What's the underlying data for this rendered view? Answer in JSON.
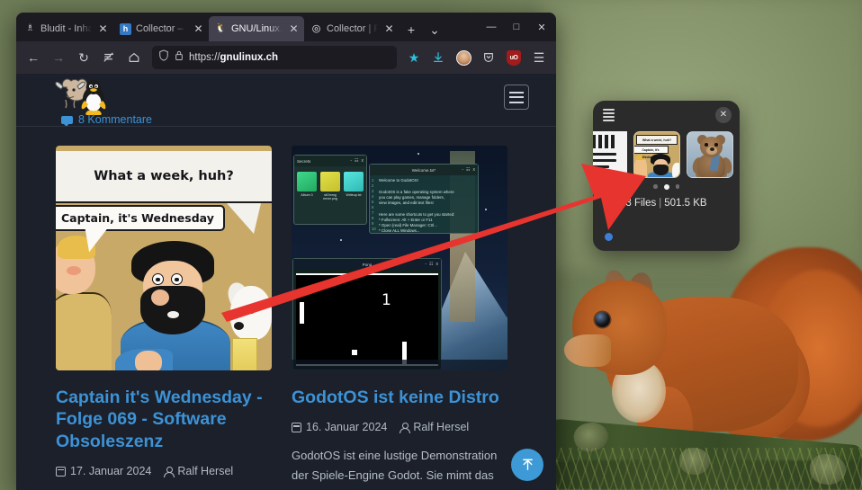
{
  "browser": {
    "tabs": [
      {
        "title": "Bludit - Inha",
        "favicon": "bludit-icon",
        "active": false
      },
      {
        "title": "Collector – N",
        "favicon": "h-icon",
        "active": false
      },
      {
        "title": "GNU/Linux.c",
        "favicon": "gnulinux-icon",
        "active": true
      },
      {
        "title": "Collector | F",
        "favicon": "collector-icon",
        "active": false
      }
    ],
    "new_tab_label": "+",
    "tab_list_label": "⌄",
    "window_controls": {
      "minimize": "—",
      "maximize": "□",
      "close": "✕"
    },
    "nav": {
      "back": "←",
      "forward": "→",
      "reload": "↻",
      "reader": "reader-mode",
      "home": "⌂"
    },
    "urlbar": {
      "shield_icon": "shield-icon",
      "lock_icon": "lock-icon",
      "protocol": "https://",
      "domain": "gnulinux.ch",
      "bookmark_icon": "star-filled-icon",
      "bookmark_color": "#2ac3de"
    },
    "toolbar_right": {
      "downloads": "↓",
      "account": "account-avatar",
      "pocket": "pocket-icon",
      "ublock": "uO",
      "ublock_color": "#a31c1c",
      "appmenu": "☰"
    }
  },
  "site": {
    "logo": "gnu-tux-logo",
    "menu_button": "hamburger-menu",
    "comments_link": "8 Kommentare",
    "articles": [
      {
        "title": "Captain it's Wednesday - Folge 069 - Software Obsoleszenz",
        "date": "17. Januar 2024",
        "author": "Ralf Hersel",
        "thumb": "tintin-comic",
        "comic_bubble_top": "What a week, huh?",
        "comic_bubble_bottom": "Captain, it's Wednesday",
        "excerpt": ""
      },
      {
        "title": "GodotOS ist keine Distro",
        "date": "16. Januar 2024",
        "author": "Ralf Hersel",
        "thumb": "godotos-screenshot",
        "excerpt": "GodotOS ist eine lustige Demonstration der Spiele-Engine Godot. Sie mimt das"
      }
    ],
    "godot_window_titles": {
      "folder": "Secrets",
      "text": "Welcome.txt*",
      "game": "Pong"
    },
    "godot_files": [
      "Album 3",
      "stOmmg never.png",
      "Writeup.txt"
    ],
    "godot_text_lines": [
      "Welcome to GodotOS!",
      "",
      "GodotOS is a fake operating system where",
      "you can play games, manage folders,",
      "view images, and edit text files!",
      "",
      "Here are some shortcuts to get you started:",
      "  * Fullscreen: Alt + Enter or F11",
      "  * Open (real) File Manager: Ctrl...",
      "  * Close ALL Windows..."
    ],
    "godot_line_numbers": [
      "1",
      "2",
      "3",
      "4",
      "5",
      "6",
      "7",
      "8",
      "9",
      "10"
    ],
    "pong_score": "1",
    "scroll_top_button": "↑"
  },
  "collector": {
    "menu_icon": "hamburger-menu-icon",
    "close_icon": "✕",
    "thumbnails": [
      {
        "name": "document-thumbnail",
        "kind": "document"
      },
      {
        "name": "comic-thumbnail",
        "kind": "image",
        "caption_top": "What a week, huh?",
        "caption_bottom": "Captain, it's Wednesday"
      },
      {
        "name": "teddy-bear-thumbnail",
        "kind": "image"
      }
    ],
    "pager": {
      "count": 3,
      "active_index": 1
    },
    "file_count": "3 Files",
    "separator": "|",
    "total_size": "501.5 KB",
    "status_dot_color": "#3d7ed6"
  },
  "annotation": {
    "arrow": "red-arrow",
    "color": "#e8342f"
  },
  "desktop": {
    "wallpaper": "red-squirrel-on-branch"
  }
}
